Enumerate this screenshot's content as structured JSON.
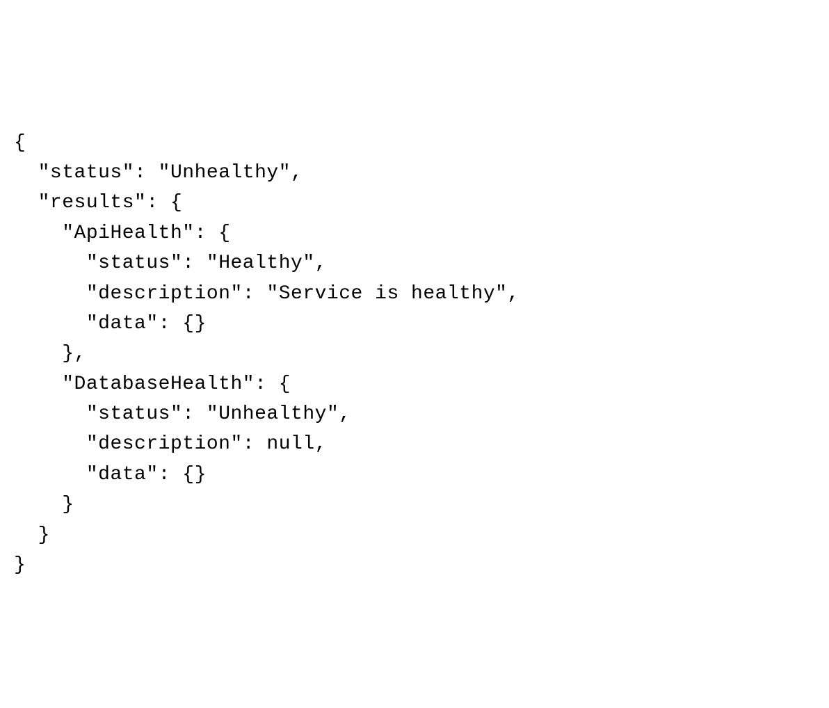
{
  "content": {
    "status": "Unhealthy",
    "results": {
      "ApiHealth": {
        "status": "Healthy",
        "description": "Service is healthy",
        "data": {}
      },
      "DatabaseHealth": {
        "status": "Unhealthy",
        "description": null,
        "data": {}
      }
    }
  },
  "keys": {
    "status": "status",
    "results": "results",
    "apiHealth": "ApiHealth",
    "description": "description",
    "data": "data",
    "databaseHealth": "DatabaseHealth"
  },
  "tokens": {
    "open_brace": "{",
    "close_brace": "}",
    "close_brace_comma": "},",
    "quote": "\"",
    "colon_space": ": ",
    "comma": ",",
    "null": "null",
    "empty_object": "{}"
  },
  "indent": {
    "i1": "  ",
    "i2": "    ",
    "i3": "      "
  }
}
